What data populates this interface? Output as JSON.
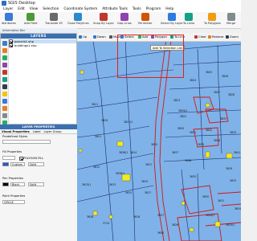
{
  "window": {
    "title": "SGIS Desktop"
  },
  "menu": [
    "Layer",
    "Edit",
    "View",
    "Selection",
    "Coordinate System",
    "Attribute Tools",
    "Tools",
    "Program",
    "Help"
  ],
  "ribbon": {
    "tools": [
      {
        "label": "Attributes",
        "color": "#3a7bd5"
      },
      {
        "label": "Add Field",
        "color": "#4a9a3a"
      },
      {
        "label": "Translate XY",
        "color": "#6a6a6a"
      },
      {
        "label": "Close Polylines",
        "color": "#2a8ad0"
      },
      {
        "label": "Snap By Layer",
        "color": "#c0392b"
      },
      {
        "label": "Gap Lines",
        "color": "#8e44ad"
      },
      {
        "label": "Perimeter",
        "color": "#d35400"
      },
      {
        "label": "Select By Layer",
        "color": "#2c7be5"
      },
      {
        "label": "To Lines",
        "color": "#16a085"
      },
      {
        "label": "To Polygons",
        "color": "#f39c12"
      },
      {
        "label": "Merge",
        "color": "#7f8c8d"
      }
    ]
  },
  "subbar": {
    "text": "Information Bar"
  },
  "layers": {
    "header": "LAYERS",
    "items": [
      {
        "name": "parcels1.shp",
        "checked": true,
        "selected": true
      },
      {
        "name": "buildings1.shp",
        "checked": true,
        "selected": false
      }
    ],
    "side_icon_colors": [
      "#3a7bd5",
      "#e67e22",
      "#27ae60",
      "#8e44ad",
      "#c0392b",
      "#16a085",
      "#2c3e50",
      "#f1c40f",
      "#3a7bd5",
      "#e67e22",
      "#7f8c8d",
      "#27ae60",
      "#c0392b"
    ]
  },
  "layer_properties": {
    "header": "LAYER PROPERTIES",
    "tabs": [
      "Visual Properties",
      "Label",
      "Layer Group"
    ],
    "predefined_label": "Predefined Styles",
    "fill_label": "Fill Properties",
    "polygon_fill_label": "POLYGON FILL",
    "fill_style": "Custom",
    "fill_pattern": "Solid",
    "fill_color": "#2255dd",
    "pen_label": "Pen Properties",
    "pen_color_name": "Black",
    "pen_style": "Solid",
    "point_label": "Point Properties",
    "point_shape": "CIRCLE"
  },
  "map_toolbar": {
    "items": [
      {
        "label": "Up"
      },
      {
        "label": "Down"
      },
      {
        "label": "Move"
      },
      {
        "label": "Select"
      },
      {
        "label": "Add"
      },
      {
        "label": "Polygon"
      },
      {
        "label": "To Line"
      },
      {
        "label": "Clear"
      },
      {
        "label": "Restore"
      },
      {
        "label": "Zoom"
      }
    ],
    "tooltip": "Add To Selection List"
  },
  "map": {
    "background": "#7fb2e8",
    "parcel_labels": [
      "3811",
      "3829",
      "3823",
      "3824",
      "3825",
      "3826",
      "3827",
      "3828",
      "3822",
      "3830",
      "3831",
      "3832",
      "3833",
      "3834",
      "3835",
      "3836",
      "3637",
      "3638",
      "3821",
      "3821/1",
      "3836/1",
      "3638/1",
      "3624",
      "3621",
      "3620",
      "3612",
      "3613",
      "3619",
      "3615",
      "3617",
      "3618",
      "3714",
      "3615/1",
      "3627",
      "3626",
      "3630",
      "3631",
      "3633",
      "3626/1",
      "3633/1",
      "3634",
      "3635",
      "3616",
      "3829/1",
      "3639",
      "3641",
      "3654"
    ]
  }
}
